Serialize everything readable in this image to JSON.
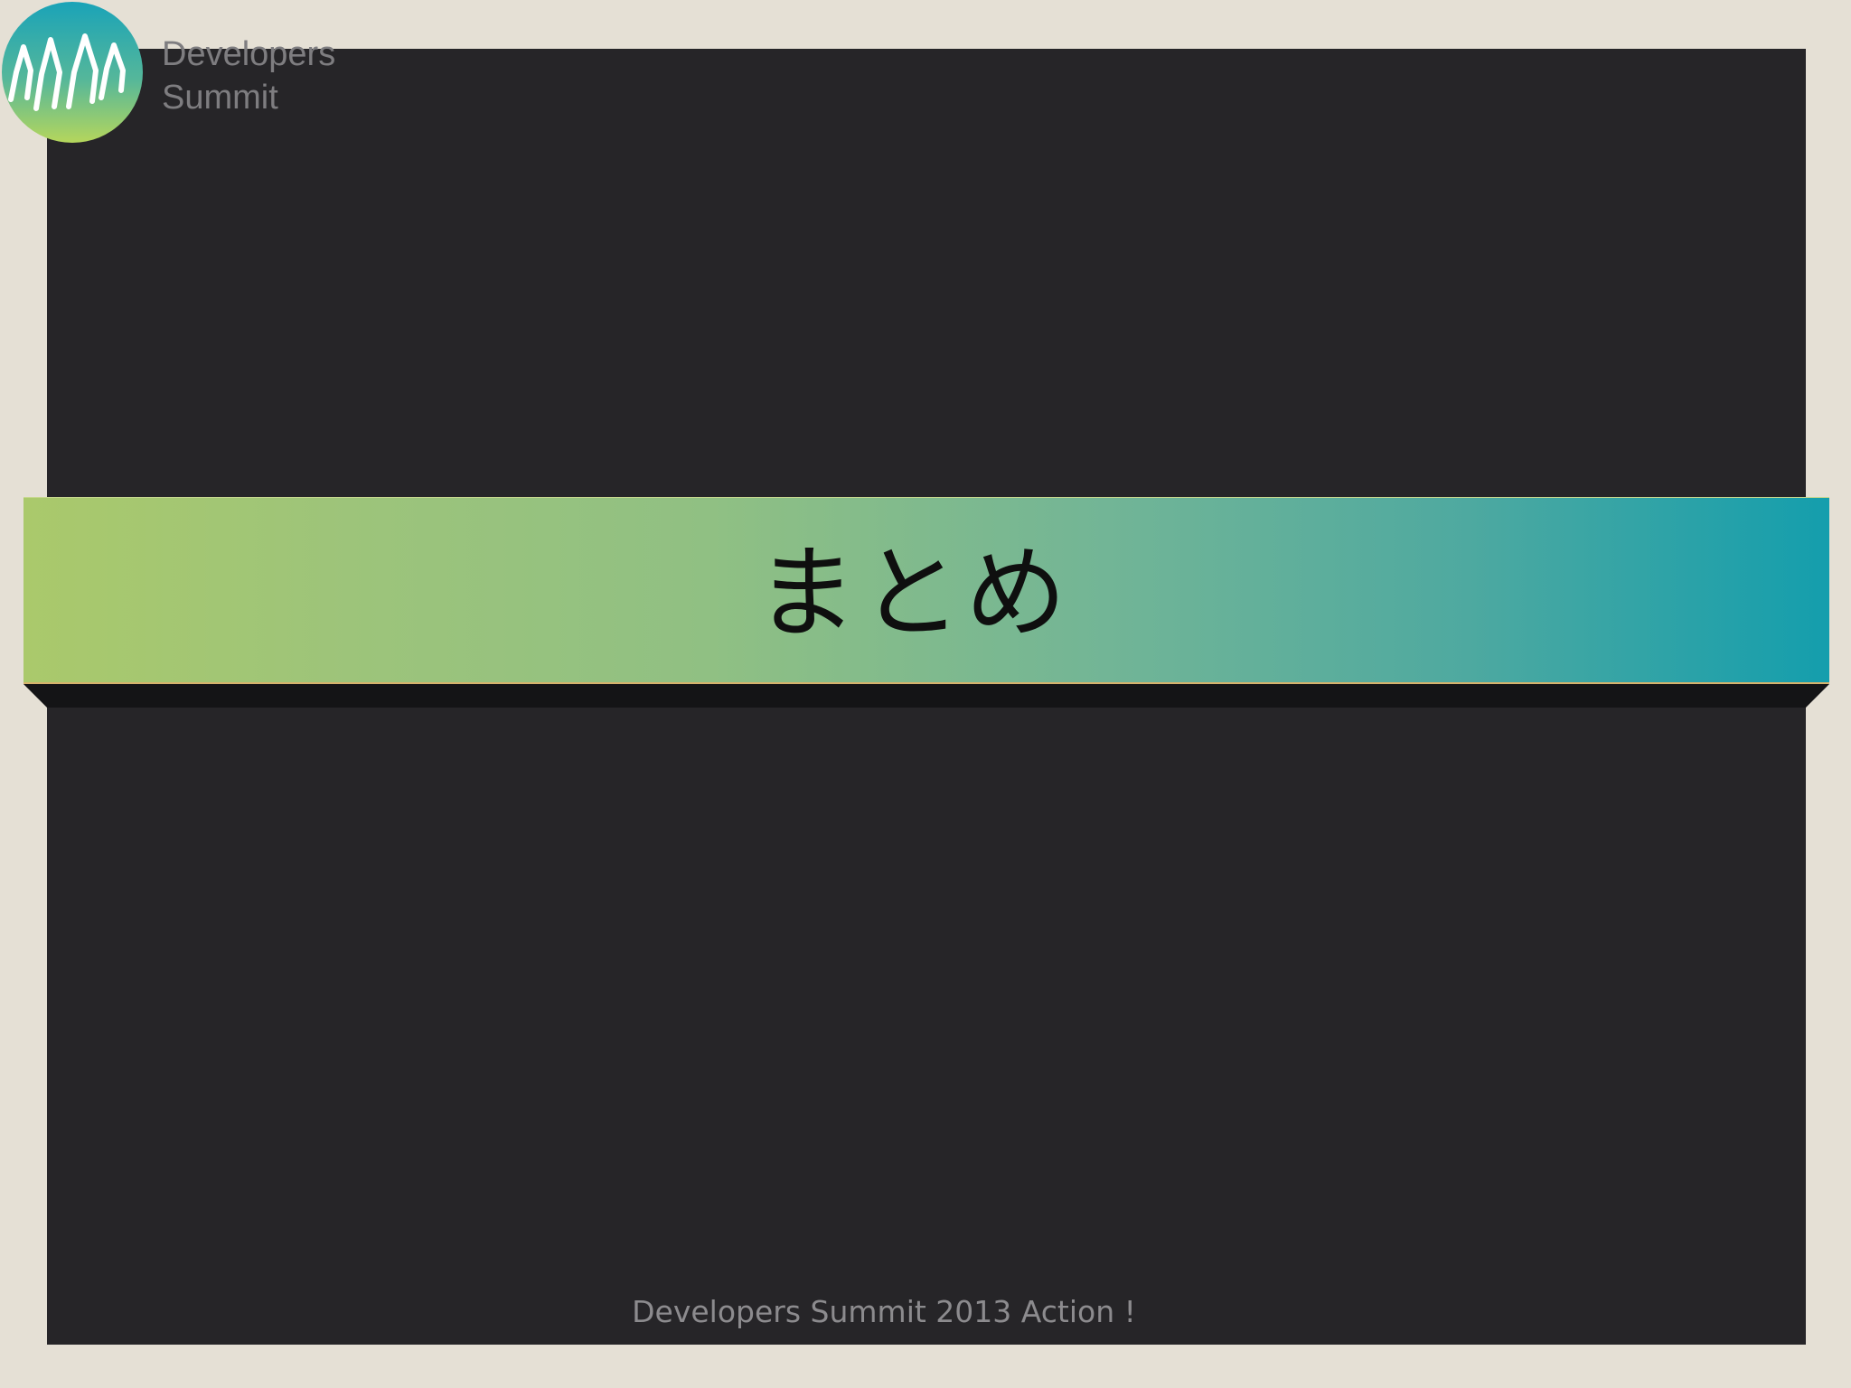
{
  "logo": {
    "icon": "developers-summit-logo-icon",
    "line1": "Developers",
    "line2": "Summit"
  },
  "banner": {
    "title": "まとめ"
  },
  "footer": {
    "text": "Developers Summit 2013 Action !"
  },
  "colors": {
    "background": "#e5e0d5",
    "panel": "#262528",
    "banner_start": "#aac96b",
    "banner_end": "#149ead",
    "logo_text": "#7e7d80",
    "footer_text": "#8c8b8e"
  }
}
